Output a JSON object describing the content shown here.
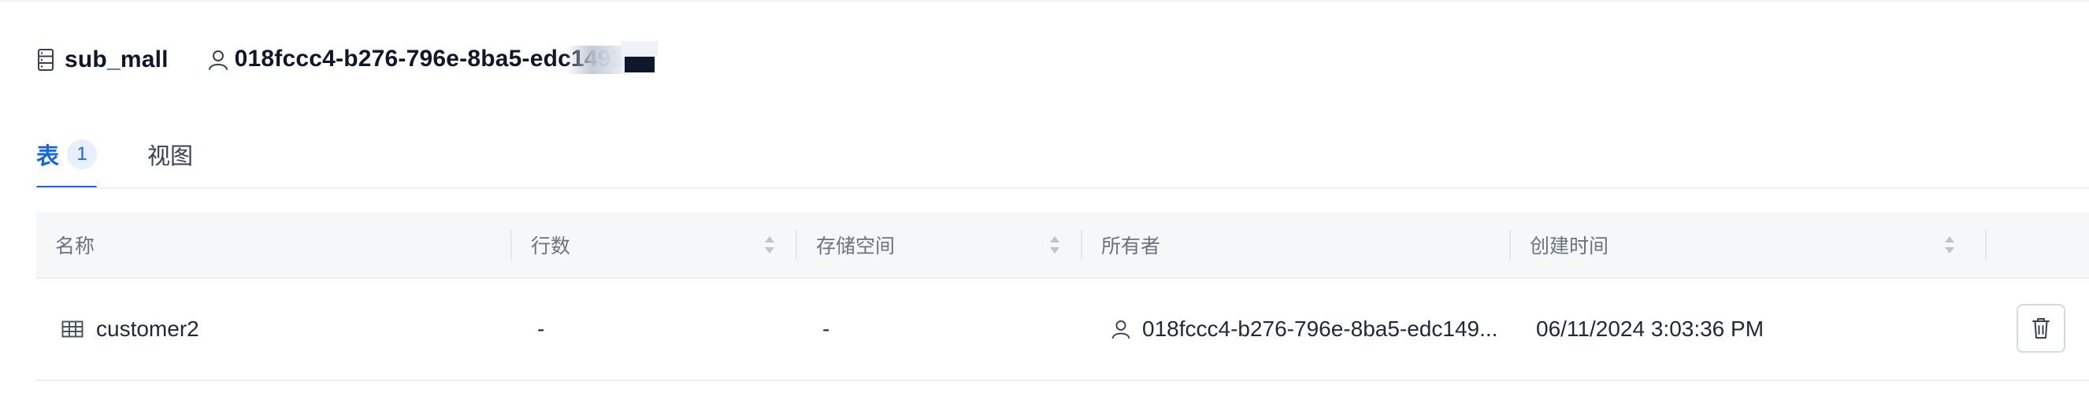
{
  "header": {
    "db_icon": "database-icon",
    "db_name": "sub_mall",
    "owner_icon": "user-icon",
    "owner_id": "018fccc4-b276-796e-8ba5-edc1493"
  },
  "tabs": [
    {
      "label": "表",
      "count": "1",
      "active": true
    },
    {
      "label": "视图",
      "active": false
    }
  ],
  "table": {
    "columns": [
      {
        "label": "名称",
        "sortable": false
      },
      {
        "label": "行数",
        "sortable": true
      },
      {
        "label": "存储空间",
        "sortable": true
      },
      {
        "label": "所有者",
        "sortable": false
      },
      {
        "label": "创建时间",
        "sortable": true
      },
      {
        "label": "",
        "sortable": false
      }
    ],
    "rows": [
      {
        "icon": "table-icon",
        "name": "customer2",
        "row_count": "-",
        "storage": "-",
        "owner_icon": "user-icon",
        "owner": "018fccc4-b276-796e-8ba5-edc149...",
        "created_at": "06/11/2024 3:03:36 PM",
        "action_icon": "trash-icon"
      }
    ]
  },
  "colors": {
    "accent": "#1565e6",
    "header_bg": "#f6f7f9",
    "text": "#1f2937",
    "muted": "#6b7280"
  }
}
